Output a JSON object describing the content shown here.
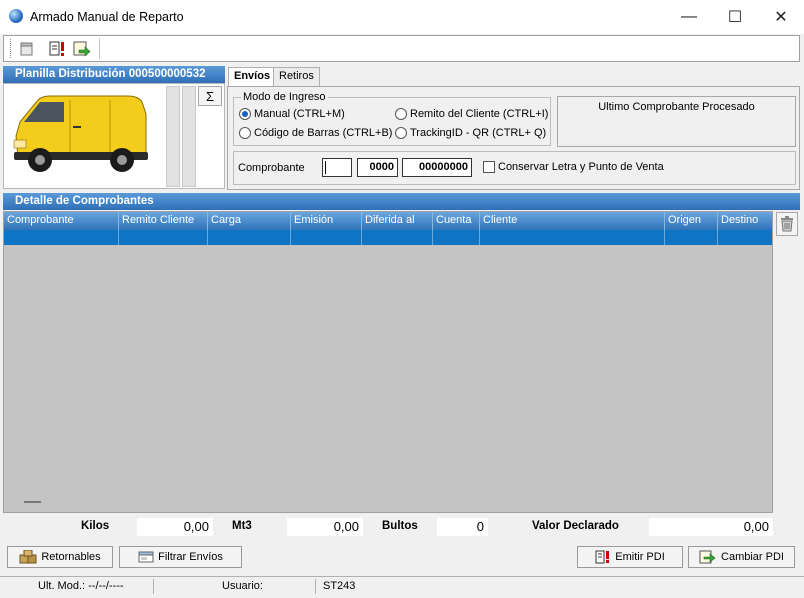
{
  "window": {
    "title": "Armado Manual de Reparto",
    "controls": {
      "minimize": "—",
      "maximize": "☐",
      "close": "✕"
    }
  },
  "toolbar": {
    "icons": [
      "document-icon",
      "document-alert-icon",
      "export-arrow-icon"
    ]
  },
  "planilla": {
    "header": "Planilla Distribución 000500000532",
    "sigma_label": "Σ"
  },
  "tabs": [
    {
      "label": "Envíos",
      "active": true
    },
    {
      "label": "Retiros",
      "active": false
    }
  ],
  "modo_ingreso": {
    "legend": "Modo de Ingreso",
    "options": [
      {
        "label": "Manual (CTRL+M)",
        "checked": true
      },
      {
        "label": "Remito del Cliente (CTRL+I)",
        "checked": false
      },
      {
        "label": "Código de Barras (CTRL+B)",
        "checked": false
      },
      {
        "label": "TrackingID - QR (CTRL+ Q)",
        "checked": false
      }
    ]
  },
  "ultimo": {
    "title": "Ultimo Comprobante Procesado"
  },
  "comprobante": {
    "label": "Comprobante",
    "letra": "",
    "punto_venta": "0000",
    "numero": "00000000",
    "conservar_label": "Conservar Letra y Punto de Venta",
    "conservar_checked": false
  },
  "detalle": {
    "header": "Detalle de Comprobantes",
    "columns": [
      "Comprobante",
      "Remito Cliente",
      "Carga",
      "Emisión",
      "Diferida al",
      "Cuenta",
      "Cliente",
      "Origen",
      "Destino"
    ]
  },
  "totals": {
    "kilos_label": "Kilos",
    "kilos": "0,00",
    "mt3_label": "Mt3",
    "mt3": "0,00",
    "bultos_label": "Bultos",
    "bultos": "0",
    "valor_label": "Valor Declarado",
    "valor": "0,00"
  },
  "buttons": {
    "retornables": "Retornables",
    "filtrar": "Filtrar Envíos",
    "emitir": "Emitir PDI",
    "cambiar": "Cambiar PDI"
  },
  "status": {
    "ult_mod": "Ult. Mod.: --/--/----",
    "usuario_label": "Usuario:",
    "usuario": "ST243"
  },
  "colors": {
    "header_blue": "#2f6fb7",
    "selected_row": "#0f74c4",
    "grid_background": "#c4c4c4"
  }
}
